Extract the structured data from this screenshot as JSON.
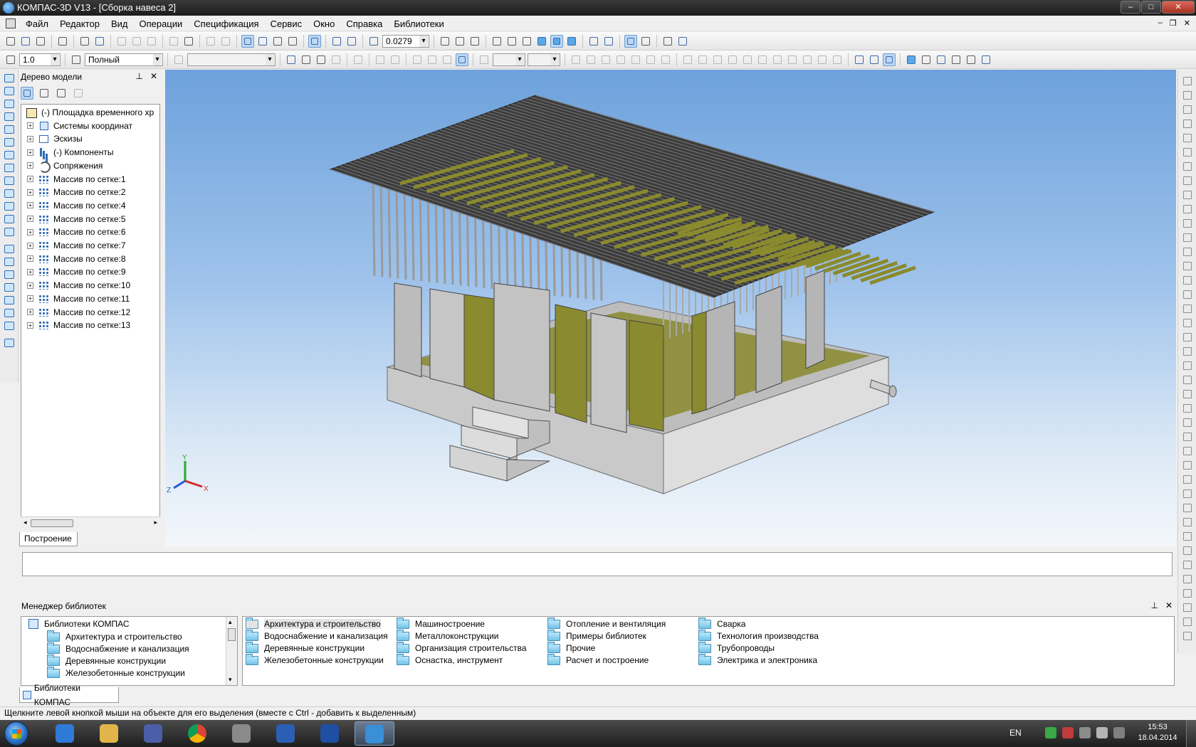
{
  "window": {
    "title": "КОМПАС-3D V13 - [Сборка навеса 2]"
  },
  "menu": {
    "items": [
      "Файл",
      "Редактор",
      "Вид",
      "Операции",
      "Спецификация",
      "Сервис",
      "Окно",
      "Справка",
      "Библиотеки"
    ]
  },
  "toolbar": {
    "zoom_value": "0.0279",
    "step_value": "1.0",
    "line_style": "Полный"
  },
  "model_tree": {
    "title": "Дерево модели",
    "tab_label": "Построение",
    "items": [
      {
        "label": "(-) Площадка временного хр",
        "icon": "assembly-icon",
        "level": 0
      },
      {
        "label": "Системы координат",
        "icon": "coordinate-system-icon",
        "level": 1
      },
      {
        "label": "Эскизы",
        "icon": "sketch-icon",
        "level": 1
      },
      {
        "label": "(-) Компоненты",
        "icon": "components-icon",
        "level": 1
      },
      {
        "label": "Сопряжения",
        "icon": "mates-icon",
        "level": 1
      },
      {
        "label": "Массив по сетке:1",
        "icon": "grid-array-icon",
        "level": 1
      },
      {
        "label": "Массив по сетке:2",
        "icon": "grid-array-icon",
        "level": 1
      },
      {
        "label": "Массив по сетке:4",
        "icon": "grid-array-icon",
        "level": 1
      },
      {
        "label": "Массив по сетке:5",
        "icon": "grid-array-icon",
        "level": 1
      },
      {
        "label": "Массив по сетке:6",
        "icon": "grid-array-icon",
        "level": 1
      },
      {
        "label": "Массив по сетке:7",
        "icon": "grid-array-icon",
        "level": 1
      },
      {
        "label": "Массив по сетке:8",
        "icon": "grid-array-icon",
        "level": 1
      },
      {
        "label": "Массив по сетке:9",
        "icon": "grid-array-icon",
        "level": 1
      },
      {
        "label": "Массив по сетке:10",
        "icon": "grid-array-icon",
        "level": 1
      },
      {
        "label": "Массив по сетке:11",
        "icon": "grid-array-icon",
        "level": 1
      },
      {
        "label": "Массив по сетке:12",
        "icon": "grid-array-icon",
        "level": 1
      },
      {
        "label": "Массив по сетке:13",
        "icon": "grid-array-icon",
        "level": 1
      }
    ]
  },
  "viewport": {
    "axes": {
      "x": "X",
      "y": "Y",
      "z": "Z"
    },
    "colors": {
      "accent_panel": "#8a8a2e",
      "frame": "#b9b9b9",
      "roof": "#3c3c3c"
    }
  },
  "library_manager": {
    "title": "Менеджер библиотек",
    "tab_label": "Библиотеки КОМПАС",
    "tree": {
      "root": "Библиотеки КОМПАС",
      "children": [
        "Архитектура и строительство",
        "Водоснабжение и канализация",
        "Деревянные конструкции",
        "Железобетонные конструкции"
      ]
    },
    "columns": [
      [
        "Архитектура и строительство",
        "Водоснабжение и канализация",
        "Деревянные конструкции",
        "Железобетонные конструкции"
      ],
      [
        "Машиностроение",
        "Металлоконструкции",
        "Организация строительства",
        "Оснастка, инструмент"
      ],
      [
        "Отопление и вентиляция",
        "Примеры библиотек",
        "Прочие",
        "Расчет и построение"
      ],
      [
        "Сварка",
        "Технология производства",
        "Трубопроводы",
        "Электрика и электроника"
      ]
    ]
  },
  "status": {
    "text": "Щелкните левой кнопкой мыши на объекте для его выделения (вместе с Ctrl - добавить к выделенным)"
  },
  "taskbar": {
    "lang": "EN",
    "time": "15:53",
    "date": "18.04.2014",
    "apps": [
      "internet-explorer-icon",
      "file-explorer-icon",
      "media-player-icon",
      "chrome-icon",
      "app-icon",
      "word-icon",
      "save-icon",
      "kompas-icon"
    ]
  }
}
